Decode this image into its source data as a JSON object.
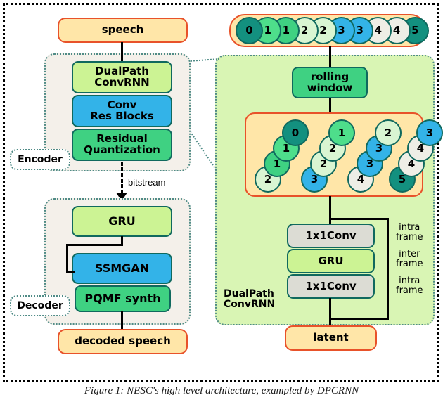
{
  "figure": {
    "caption": "Figure 1:  NESC's high level architecture, exampled by DPCRNN"
  },
  "left_panel": {
    "input_box": "speech",
    "output_box": "decoded speech",
    "encoder": {
      "label": "Encoder",
      "blocks": [
        {
          "line1": "DualPath",
          "line2": "ConvRNN",
          "color": "#ccf394"
        },
        {
          "line1": "Conv",
          "line2": "Res Blocks",
          "color": "#33b3e8"
        },
        {
          "line1": "Residual",
          "line2": "Quantization",
          "color": "#3fd182"
        }
      ]
    },
    "bitstream_label": "bitstream",
    "decoder": {
      "label": "Decoder",
      "blocks": [
        {
          "line1": "GRU",
          "line2": "",
          "color": "#ccf394"
        },
        {
          "line1": "SSMGAN",
          "line2": "",
          "color": "#33b3e8"
        },
        {
          "line1": "PQMF synth",
          "line2": "",
          "color": "#3fd182"
        }
      ]
    }
  },
  "right_panel": {
    "rolling_window_label_line1": "rolling",
    "rolling_window_label_line2": "window",
    "dualpath_label_line1": "DualPath",
    "dualpath_label_line2": "ConvRNN",
    "latent_box": "latent",
    "frame_labels": [
      {
        "line1": "intra",
        "line2": "frame"
      },
      {
        "line1": "inter",
        "line2": "frame"
      },
      {
        "line1": "intra",
        "line2": "frame"
      }
    ],
    "dualpath_blocks": [
      {
        "label": "1x1Conv",
        "color": "#dcdcd4"
      },
      {
        "label": "GRU",
        "color": "#ccf394"
      },
      {
        "label": "1x1Conv",
        "color": "#dcdcd4"
      }
    ],
    "sequence_strip": [
      {
        "value": "0",
        "color": "#13907f"
      },
      {
        "value": "1",
        "color": "#4ede8b"
      },
      {
        "value": "1",
        "color": "#3fd182"
      },
      {
        "value": "2",
        "color": "#d9f5d2"
      },
      {
        "value": "2",
        "color": "#d9f5d2"
      },
      {
        "value": "3",
        "color": "#33b3e8"
      },
      {
        "value": "3",
        "color": "#33b3e8"
      },
      {
        "value": "4",
        "color": "#eeeee6"
      },
      {
        "value": "4",
        "color": "#eeeee6"
      },
      {
        "value": "5",
        "color": "#13907f"
      }
    ],
    "windows": [
      {
        "items": [
          {
            "value": "0",
            "color": "#13907f"
          },
          {
            "value": "1",
            "color": "#4ede8b"
          },
          {
            "value": "1",
            "color": "#3fd182"
          },
          {
            "value": "2",
            "color": "#d9f5d2"
          }
        ]
      },
      {
        "items": [
          {
            "value": "1",
            "color": "#4ede8b"
          },
          {
            "value": "2",
            "color": "#d9f5d2"
          },
          {
            "value": "2",
            "color": "#d9f5d2"
          },
          {
            "value": "3",
            "color": "#33b3e8"
          }
        ]
      },
      {
        "items": [
          {
            "value": "2",
            "color": "#d9f5d2"
          },
          {
            "value": "3",
            "color": "#33b3e8"
          },
          {
            "value": "3",
            "color": "#33b3e8"
          },
          {
            "value": "4",
            "color": "#eeeee6"
          }
        ]
      },
      {
        "items": [
          {
            "value": "3",
            "color": "#33b3e8"
          },
          {
            "value": "4",
            "color": "#eeeee6"
          },
          {
            "value": "4",
            "color": "#eeeee6"
          },
          {
            "value": "5",
            "color": "#13907f"
          }
        ]
      }
    ]
  },
  "colors": {
    "io_fill": "#ffe6a8",
    "io_stroke": "#e8522a",
    "teal_stroke": "#10695e",
    "dotted_region": "#4f8b86",
    "green_region": "#d9f5b4",
    "panel_bg": "#f4f0ea"
  }
}
